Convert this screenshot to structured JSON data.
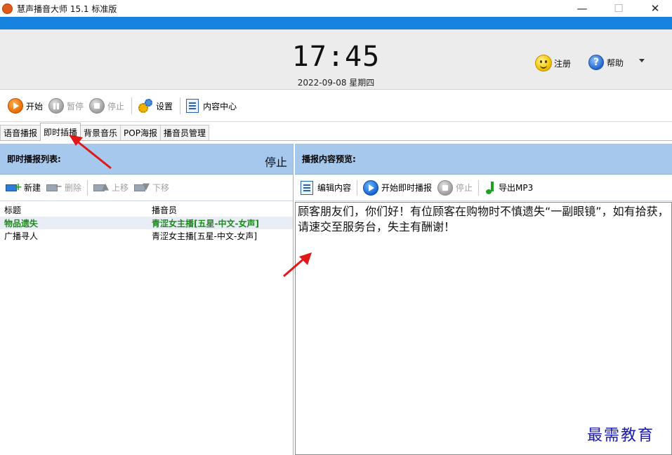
{
  "window": {
    "title": "慧声播音大师 15.1 标准版",
    "minimize": "—",
    "maximize": "☐",
    "close": "✕"
  },
  "header": {
    "time": "17:45",
    "date": "2022-09-08 星期四",
    "register_label": "注册",
    "help_label": "帮助"
  },
  "toolbar": {
    "start": "开始",
    "pause": "暂停",
    "stop": "停止",
    "settings": "设置",
    "content_center": "内容中心"
  },
  "tabs": [
    {
      "label": "语音播报"
    },
    {
      "label": "即时插播",
      "active": true
    },
    {
      "label": "背景音乐"
    },
    {
      "label": "POP海报"
    },
    {
      "label": "播音员管理"
    }
  ],
  "left": {
    "heading": "即时播报列表:",
    "status": "停止",
    "tools": {
      "new": "新建",
      "delete": "删除",
      "move_up": "上移",
      "move_down": "下移"
    },
    "columns": [
      "标题",
      "播音员"
    ],
    "rows": [
      {
        "title": "物品遗失",
        "announcer": "青涩女主播[五星-中文-女声]",
        "selected": true
      },
      {
        "title": "广播寻人",
        "announcer": "青涩女主播[五星-中文-女声]",
        "selected": false
      }
    ]
  },
  "right": {
    "heading": "播报内容预览:",
    "tools": {
      "edit": "编辑内容",
      "start_instant": "开始即时播报",
      "stop": "停止",
      "export": "导出MP3"
    },
    "preview_text": "顾客朋友们，你们好！有位顾客在购物时不慎遗失“一副眼镜”，如有拾获，请速交至服务台，失主有酬谢！"
  },
  "watermark": "最需教育",
  "colors": {
    "title_blue_bar": "#1782e0",
    "panel_header": "#a6c8ec",
    "selected_text": "#1a8a1a",
    "annotation_arrow": "#e01818"
  }
}
